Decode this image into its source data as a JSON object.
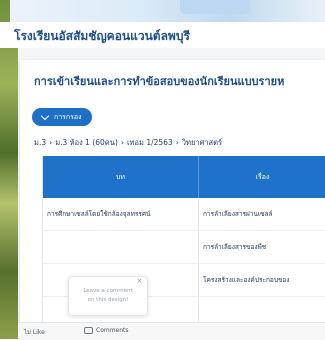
{
  "school": {
    "name": "โรงเรียนอัสสัมชัญคอนแวนต์ลพบุรี"
  },
  "page": {
    "heading": "การเข้าเรียนและการทำข้อสอบของนักเรียนแบบรายห"
  },
  "filter": {
    "button_label": "การกรอง"
  },
  "breadcrumb": [
    "ม.3",
    "ม.3 ห้อง 1 (60คน)",
    "เทอม 1/2563",
    "วิทยาศาสตร์"
  ],
  "table": {
    "columns": [
      "บท",
      "เรื่อง"
    ],
    "rows": [
      {
        "chapter": "การศึกษาเซลล์โดยใช้กล้องจุลทรรศน์",
        "topic": "การลำเลียงสารผ่านเซลล์"
      },
      {
        "chapter": "",
        "topic": "การลำเลียงสารของพืช"
      },
      {
        "chapter": "",
        "topic": "โครงสร้างและองค์ประกอบของ"
      }
    ]
  },
  "comment_popup": {
    "line1": "Leave a comment",
    "line2": "on this design!"
  },
  "bottom_bar": {
    "like_label": "ไม่ Like",
    "comments_label": "Comments"
  },
  "colors": {
    "primary": "#1e72c9",
    "title": "#1f4f8f"
  }
}
